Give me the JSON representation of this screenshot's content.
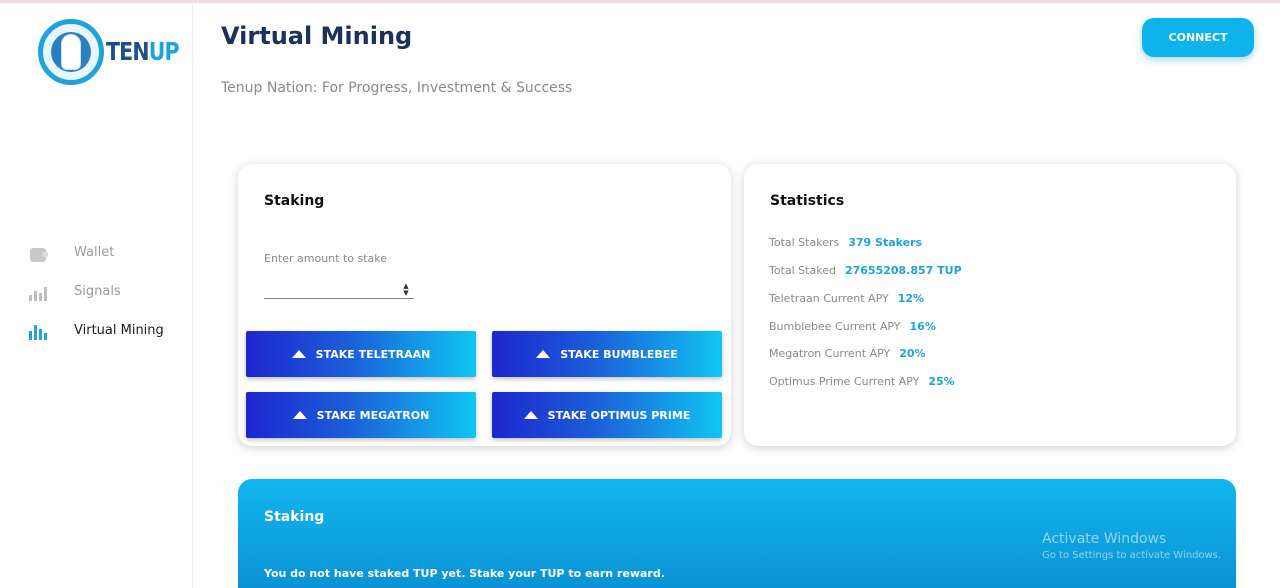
{
  "brand": {
    "logo_text_a": "TEN",
    "logo_text_b": "UP"
  },
  "sidebar": {
    "items": [
      {
        "label": "Wallet",
        "icon": "wallet-icon"
      },
      {
        "label": "Signals",
        "icon": "signals-icon"
      },
      {
        "label": "Virtual Mining",
        "icon": "bar-chart-icon",
        "active": true
      }
    ]
  },
  "header": {
    "title": "Virtual Mining",
    "subtitle": "Tenup Nation: For Progress, Investment & Success",
    "connect_label": "CONNECT"
  },
  "staking": {
    "title": "Staking",
    "amount_label": "Enter amount to stake",
    "amount_value": "",
    "buttons": [
      "STAKE TELETRAAN",
      "STAKE BUMBLEBEE",
      "STAKE MEGATRON",
      "STAKE OPTIMUS PRIME"
    ]
  },
  "statistics": {
    "title": "Statistics",
    "rows": [
      {
        "label": "Total Stakers",
        "value": "379 Stakers"
      },
      {
        "label": "Total Staked",
        "value": "27655208.857 TUP"
      },
      {
        "label": "Teletraan Current APY",
        "value": "12%"
      },
      {
        "label": "Bumblebee Current APY",
        "value": "16%"
      },
      {
        "label": "Megatron Current APY",
        "value": "20%"
      },
      {
        "label": "Optimus Prime Current APY",
        "value": "25%"
      }
    ]
  },
  "banner": {
    "title": "Staking",
    "message": "You do not have staked TUP yet. Stake your TUP to earn reward."
  },
  "watermark": {
    "title": "Activate Windows",
    "subtitle": "Go to Settings to activate Windows."
  },
  "colors": {
    "accent": "#1fa3dd",
    "title": "#1c3159",
    "button_start": "#1d26cf",
    "button_end": "#10c6f2"
  }
}
